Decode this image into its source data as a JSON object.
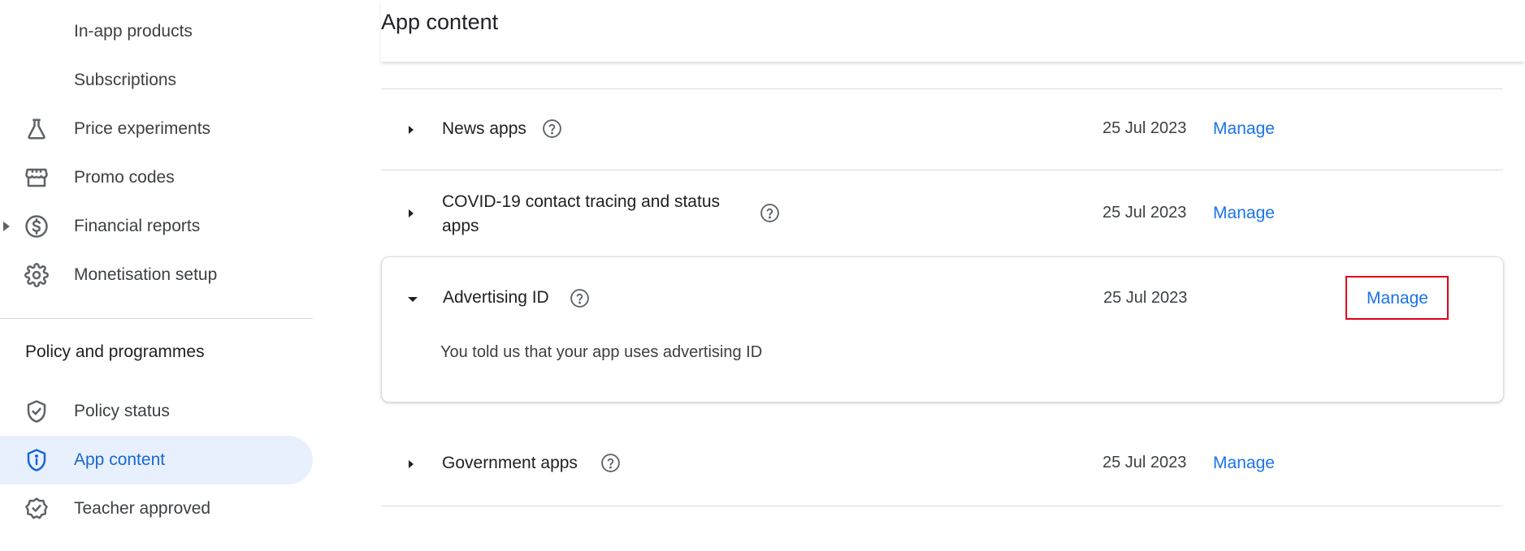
{
  "sidebar": {
    "items": [
      {
        "label": "In-app products"
      },
      {
        "label": "Subscriptions"
      },
      {
        "label": "Price experiments",
        "icon": "flask-icon"
      },
      {
        "label": "Promo codes",
        "icon": "storefront-icon"
      },
      {
        "label": "Financial reports",
        "icon": "dollar-circle-icon"
      },
      {
        "label": "Monetisation setup",
        "icon": "gear-icon"
      }
    ],
    "section_heading": "Policy and programmes",
    "policy_items": [
      {
        "label": "Policy status",
        "icon": "shield-check-icon"
      },
      {
        "label": "App content",
        "icon": "shield-info-icon",
        "active": true
      },
      {
        "label": "Teacher approved",
        "icon": "badge-check-icon"
      }
    ]
  },
  "main": {
    "title": "App content",
    "rows": [
      {
        "name": "News apps",
        "date": "25 Jul 2023",
        "action": "Manage"
      },
      {
        "name": "COVID-19 contact tracing and status apps",
        "name_line1": "COVID-19 contact tracing and status",
        "name_line2": "apps",
        "date": "25 Jul 2023",
        "action": "Manage"
      },
      {
        "name": "Advertising ID",
        "date": "25 Jul 2023",
        "action": "Manage",
        "expanded": true,
        "description": "You told us that your app uses advertising ID"
      },
      {
        "name": "Government apps",
        "date": "25 Jul 2023",
        "action": "Manage"
      }
    ]
  },
  "colors": {
    "accent": "#1a73e8",
    "active_bg": "#e8f0fe",
    "highlight": "#e0001b"
  }
}
